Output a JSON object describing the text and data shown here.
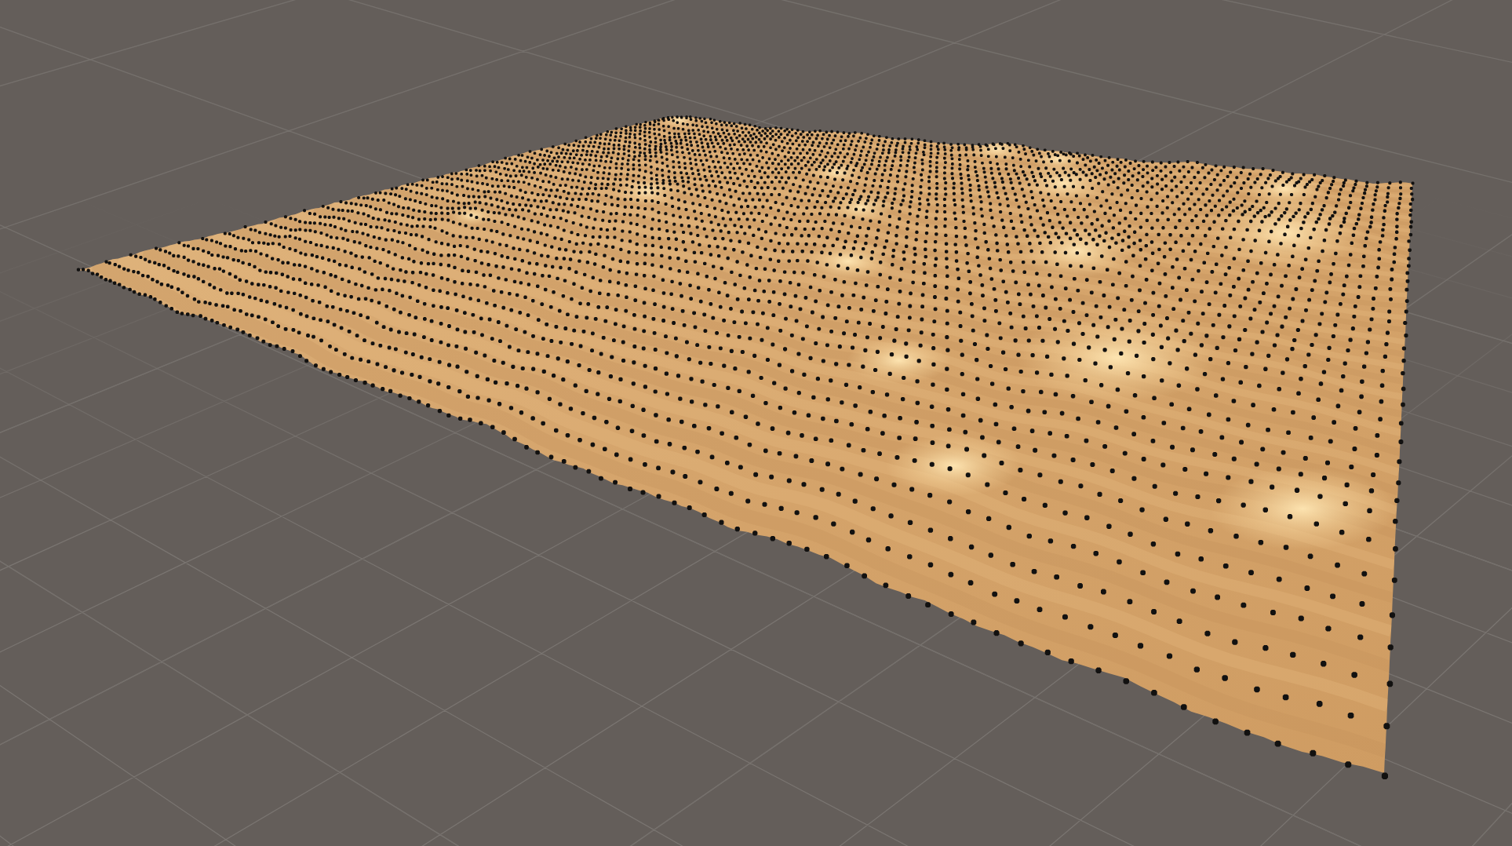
{
  "scene_view": {
    "grid": true
  }
}
